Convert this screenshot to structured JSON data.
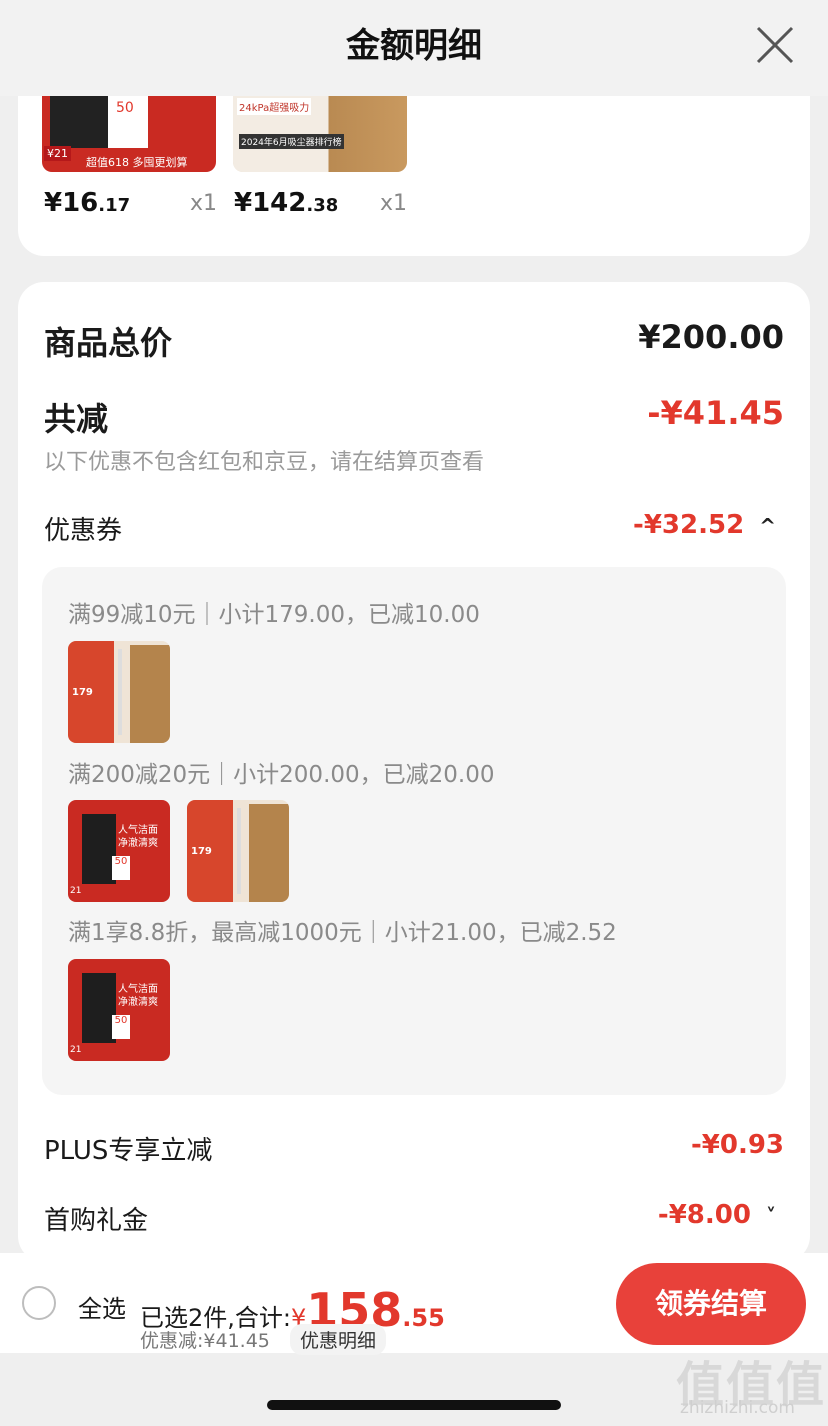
{
  "header": {
    "title": "金额明细",
    "close_icon": "close-icon"
  },
  "top_products": [
    {
      "price_main": "¥16",
      "price_dec": ".17",
      "qty": "x1",
      "badge": "50",
      "label": "超值618 多囤更划算",
      "tag": "¥21"
    },
    {
      "price_main": "¥142",
      "price_dec": ".38",
      "qty": "x1",
      "label1": "2024年6月吸尘器排行榜",
      "label2": "24kPa超强吸力"
    }
  ],
  "summary": {
    "total_label": "商品总价",
    "total_value": "¥200.00",
    "reduce_label": "共减",
    "reduce_value": "-¥41.45",
    "note": "以下优惠不包含红包和京豆，请在结算页查看",
    "coupon_label": "优惠券",
    "coupon_value": "-¥32.52",
    "coupon_chevron": "^",
    "plus_label": "PLUS专享立减",
    "plus_value": "-¥0.93",
    "first_label": "首购礼金",
    "first_value": "-¥8.00",
    "first_chevron": "˅"
  },
  "coupons": [
    {
      "text": "满99减10元｜小计179.00，已减10.00"
    },
    {
      "text": "满200减20元｜小计200.00，已减20.00"
    },
    {
      "text": "满1享8.8折，最高减1000元｜小计21.00，已减2.52"
    }
  ],
  "thumb_text": {
    "vac_price": "179",
    "cleanser_line1": "人气洁面",
    "cleanser_line2": "净澈清爽",
    "cleanser_badge": "50",
    "cleanser_price": "21",
    "cleanser_footer": "超值618 多囤更划算"
  },
  "bottom": {
    "select_all": "全选",
    "selected_text": "已选2件,合计:",
    "currency": "¥",
    "total_main": "158",
    "total_dec": ".55",
    "discount_text": "优惠减:¥41.45",
    "detail_pill": "优惠明细",
    "checkout": "领券结算"
  },
  "watermark": {
    "big": "值值值",
    "small": "zhizhizhi.com"
  },
  "colors": {
    "accent": "#e2382c",
    "button": "#e8413a"
  }
}
